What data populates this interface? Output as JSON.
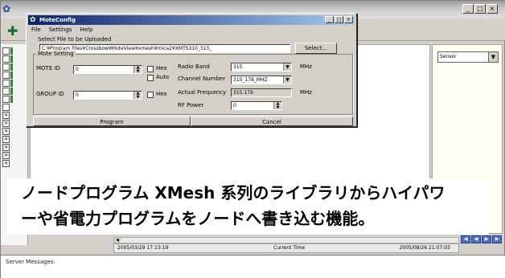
{
  "background_window": {
    "title": "",
    "window_buttons": [
      "_",
      "□",
      "×"
    ],
    "right_panel_select": "Sensor",
    "left_strip_checks": [
      "",
      "",
      "",
      "",
      "",
      "",
      "",
      "",
      "",
      "",
      "",
      "",
      "",
      "",
      "×",
      "×",
      "×",
      "×",
      "×",
      "×",
      "×",
      "×"
    ],
    "time_bar": {
      "start": "2005/03/29 17:13:19",
      "label": "Current Time",
      "end": "2005/08/26 21:07:03"
    },
    "nav_buttons": [
      "◀",
      "◀",
      "▶",
      "▶"
    ],
    "server_messages_label": "Server Messages:"
  },
  "dialog": {
    "title": "MoteConfig",
    "window_buttons": [
      "_",
      "□",
      "×"
    ],
    "menu": [
      "File",
      "Settings",
      "Help"
    ],
    "select_file_label": "Select File to be Uploaded",
    "file_path": "C:¥Program Files¥Crossbow¥MoteView¥xmesh¥mica2¥XMTS310_315_",
    "select_button": "Select...",
    "mote_setting_label": "Mote Setting",
    "mote_id_label": "MOTE ID",
    "mote_id_value": "0",
    "hex_label_1": "Hex",
    "auto_label": "Auto",
    "group_id_label": "GROUP ID",
    "group_id_value": "0",
    "hex_label_2": "Hex",
    "radio_band_label": "Radio Band",
    "radio_band_value": "315",
    "radio_band_unit": "MHz",
    "channel_number_label": "Channel Number",
    "channel_number_value": "315_178_MHZ",
    "actual_frequency_label": "Actual Frequency",
    "actual_frequency_value": "315.179",
    "actual_frequency_unit": "MHz",
    "rf_power_label": "RF Power",
    "rf_power_value": "0",
    "program_button": "Program",
    "cancel_button": "Cancel"
  },
  "caption": {
    "line1": "ノードプログラム XMesh 系列のライブラリからハイパワ",
    "line2": "ーや省電力プログラムをノードへ書き込む機能。"
  }
}
